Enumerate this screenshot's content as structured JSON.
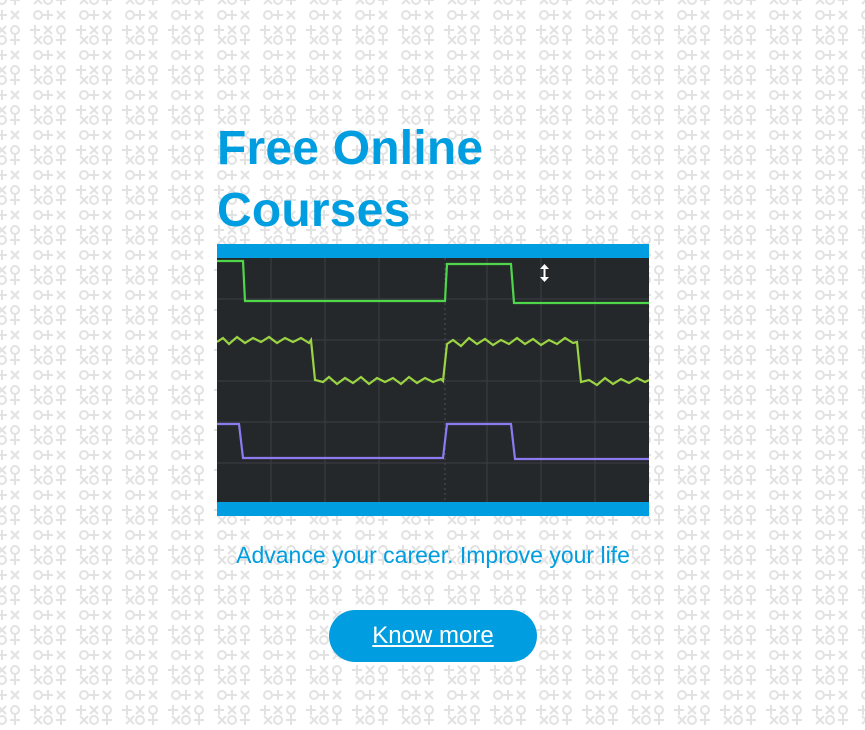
{
  "hero": {
    "title_line1": "Free Online",
    "title_line2": "Courses",
    "tagline": "Advance your career. Improve your life",
    "cta_label": "Know more"
  },
  "image": {
    "icon": "oscilloscope-waveform-image"
  },
  "colors": {
    "accent": "#009ee0",
    "background": "#ffffff",
    "pattern": "#e2e2e2",
    "scope_screen": "#25282b",
    "trace_green": "#4fd64a",
    "trace_yellow_green": "#9bd443",
    "trace_purple": "#8a7cf0"
  }
}
